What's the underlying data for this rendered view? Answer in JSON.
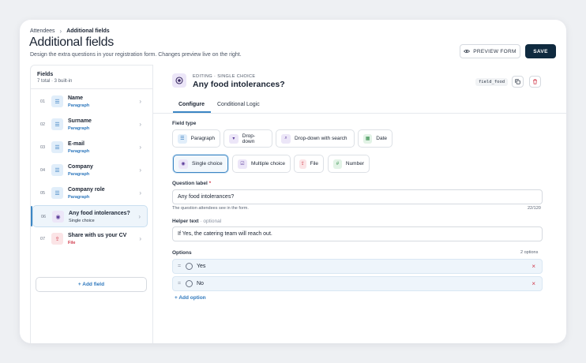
{
  "header": {
    "breadcrumb": [
      "Attendees",
      "Additional fields"
    ],
    "breadcrumb_sep": "›",
    "title": "Additional fields",
    "subtitle": "Design the extra questions in your registration form. Changes preview live on the right.",
    "preview_label": "PREVIEW FORM",
    "save_label": "SAVE"
  },
  "sidebar": {
    "title": "Fields",
    "count": "7 total · 3 built-in",
    "items": [
      {
        "num": "01",
        "name": "Name",
        "type": "Paragraph",
        "icon": "paragraph-icon"
      },
      {
        "num": "02",
        "name": "Surname",
        "type": "Paragraph",
        "icon": "paragraph-icon"
      },
      {
        "num": "03",
        "name": "E-mail",
        "type": "Paragraph",
        "icon": "paragraph-icon"
      },
      {
        "num": "04",
        "name": "Company",
        "type": "Paragraph",
        "icon": "paragraph-icon"
      },
      {
        "num": "05",
        "name": "Company role",
        "type": "Paragraph",
        "icon": "paragraph-icon"
      },
      {
        "num": "06",
        "name": "Any food intolerances?",
        "type": "Single choice",
        "icon": "radio-icon",
        "active": true
      },
      {
        "num": "07",
        "name": "Share with us your CV",
        "type": "File",
        "icon": "upload-icon"
      }
    ],
    "add_label": "+ Add field"
  },
  "editor": {
    "editing_label": "EDITING · SINGLE CHOICE",
    "title": "Any food intolerances?",
    "field_key": "field_food",
    "tabs": [
      "Configure",
      "Conditional Logic"
    ],
    "field_type_label": "Field type",
    "field_types": [
      {
        "label": "Paragraph",
        "icon": "paragraph-icon"
      },
      {
        "label": "Drop-down",
        "icon": "dropdown-icon"
      },
      {
        "label": "Drop-down with search",
        "icon": "search-icon"
      },
      {
        "label": "Date",
        "icon": "calendar-icon"
      },
      {
        "label": "Single choice",
        "icon": "radio-icon",
        "active": true
      },
      {
        "label": "Multiple choice",
        "icon": "checkbox-icon"
      },
      {
        "label": "File",
        "icon": "upload-icon"
      },
      {
        "label": "Number",
        "icon": "hash-icon"
      }
    ],
    "question_label": "Question label",
    "question_required": "*",
    "question_value": "Any food intolerances?",
    "question_help": "The question attendees see in the form.",
    "question_counter": "22/120",
    "helper_label": "Helper text",
    "helper_optional": "· optional",
    "helper_value": "If Yes, the catering team will reach out.",
    "options_label": "Options",
    "options_count": "2 options",
    "options": [
      "Yes",
      "No"
    ],
    "add_option": "+ Add option"
  },
  "colors": {
    "accent": "#3c86c4",
    "save_bg": "#0f2a3f",
    "danger": "#d0394a"
  }
}
